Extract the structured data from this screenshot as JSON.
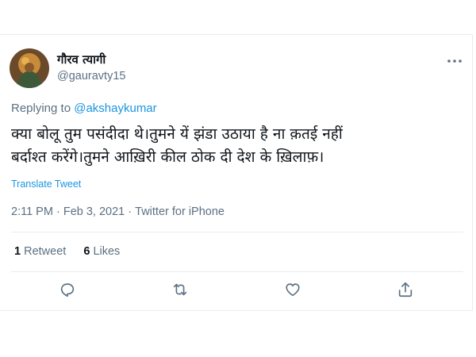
{
  "tweet": {
    "author": {
      "display_name": "गौरव त्यागी",
      "handle": "@gauravty15"
    },
    "replying_to_label": "Replying to",
    "replying_to_handle": "@akshaykumar",
    "text_line1": "क्या बोलू तुम पसंदीदा थे।तुमने यें झंडा उठाया है ना क़तई नहीं",
    "text_line2": "बर्दाश्त करेंगे।तुमने आख़िरी कील ठोक दी देश के ख़िलाफ़।",
    "translate_label": "Translate Tweet",
    "time": "2:11 PM",
    "separator": "·",
    "date": "Feb 3, 2021",
    "source": "Twitter for iPhone",
    "retweets_count": "1",
    "retweets_label": "Retweet",
    "likes_count": "6",
    "likes_label": "Likes"
  },
  "icons": {
    "more": "more-horizontal-icon",
    "reply": "reply-icon",
    "retweet": "retweet-icon",
    "like": "heart-icon",
    "share": "share-icon"
  },
  "colors": {
    "accent": "#1b95e0",
    "secondary_text": "#5b7083",
    "border": "#e6ecf0"
  }
}
